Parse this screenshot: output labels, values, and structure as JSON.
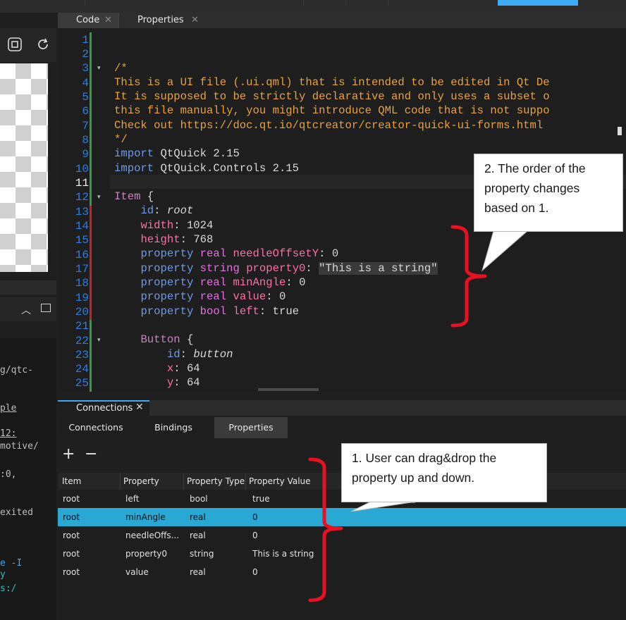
{
  "editor": {
    "tabs": [
      "Code",
      "Properties"
    ],
    "line_numbers": [
      "1",
      "2",
      "3",
      "4",
      "5",
      "6",
      "7",
      "8",
      "9",
      "10",
      "11",
      "12",
      "13",
      "14",
      "15",
      "16",
      "17",
      "18",
      "19",
      "20",
      "21",
      "22",
      "23",
      "24",
      "25"
    ],
    "lines": {
      "l3": "/*",
      "l4": "This is a UI file (.ui.qml) that is intended to be edited in Qt De",
      "l5": "It is supposed to be strictly declarative and only uses a subset o",
      "l6": "this file manually, you might introduce QML code that is not suppo",
      "l7": "Check out https://doc.qt.io/qtcreator/creator-quick-ui-forms.html ",
      "l8": "*/",
      "l9_kw": "import",
      "l9_rest": " QtQuick 2.15",
      "l10_kw": "import",
      "l10_rest": " QtQuick.Controls 2.15",
      "l12_type": "Item",
      "l12_rest": " {",
      "l13_k": "id",
      "l13_v": "root",
      "l14_k": "width",
      "l14_v": "1024",
      "l15_k": "height",
      "l15_v": "768",
      "l16_ty": "real",
      "l16_n": "needleOffsetY",
      "l16_v": "0",
      "l17_ty": "string",
      "l17_n": "property0",
      "l17_v": "\"This is a string\"",
      "l18_ty": "real",
      "l18_n": "minAngle",
      "l18_v": "0",
      "l19_ty": "real",
      "l19_n": "value",
      "l19_v": "0",
      "l20_ty": "bool",
      "l20_n": "left",
      "l20_v": "true",
      "l22_type": "Button",
      "l22_rest": " {",
      "l23_k": "id",
      "l23_v": "button",
      "l24_k": "x",
      "l24_v": "64",
      "l25_k": "y",
      "l25_v": "64",
      "property_kw": "property"
    }
  },
  "left_output": {
    "lines": [
      "g/qtc-",
      "ple",
      "12:",
      "motive/",
      ":0,",
      "exited",
      "e -I",
      "y",
      "s:/"
    ]
  },
  "bottom": {
    "panel_tab": "Connections",
    "sub_tabs": [
      "Connections",
      "Bindings",
      "Properties"
    ],
    "toolbar": {
      "add": "+",
      "remove": "−"
    },
    "columns": [
      "Item",
      "Property",
      "Property Type",
      "Property Value"
    ],
    "rows": [
      {
        "item": "root",
        "property": "left",
        "type": "bool",
        "value": "true"
      },
      {
        "item": "root",
        "property": "minAngle",
        "type": "real",
        "value": "0"
      },
      {
        "item": "root",
        "property": "needleOffs...",
        "type": "real",
        "value": "0"
      },
      {
        "item": "root",
        "property": "property0",
        "type": "string",
        "value": "This is a string"
      },
      {
        "item": "root",
        "property": "value",
        "type": "real",
        "value": "0"
      }
    ],
    "selected_row": 2
  },
  "callouts": {
    "top": "2. The order of the property changes based on 1.",
    "bottom": "1. User can drag&drop the property up and down."
  },
  "colors": {
    "accent": "#3fa9f5",
    "selection": "#29a8d3",
    "annotation_red": "#e81123",
    "line_number": "#2f7ee0",
    "comment": "#e9a33b"
  }
}
